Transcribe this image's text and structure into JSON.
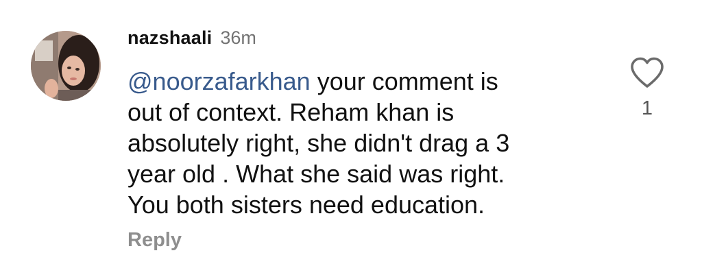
{
  "comment": {
    "username": "nazshaali",
    "timestamp": "36m",
    "mention": "@noorzafarkhan",
    "lines": [
      " your comment is",
      "out of context. Reham khan is",
      "absolutely right, she didn't drag a 3",
      "year old . What she said was right.",
      "You both sisters need education."
    ],
    "reply_label": "Reply",
    "like_icon": "heart-outline",
    "like_count": "1"
  },
  "colors": {
    "mention": "#385a8c",
    "secondary_text": "#737373",
    "reply": "#8e8e8e"
  }
}
